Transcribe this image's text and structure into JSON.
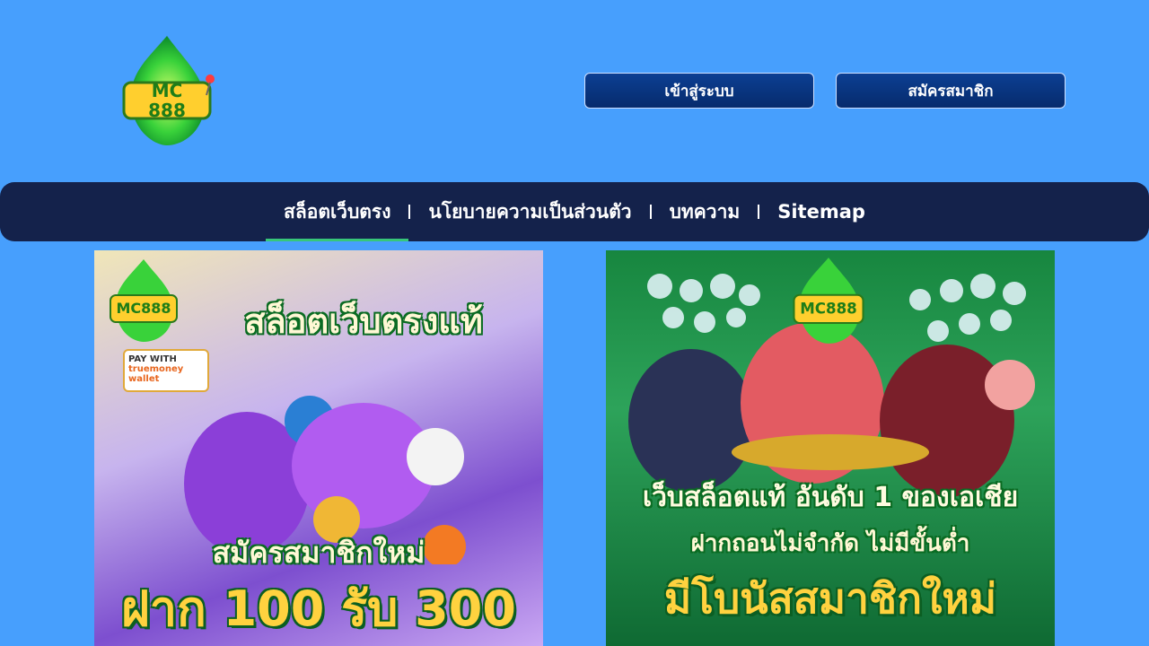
{
  "header": {
    "logo_text": "MC 888",
    "login_label": "เข้าสู่ระบบ",
    "register_label": "สมัครสมาชิก"
  },
  "nav": {
    "items": [
      {
        "label": "สล็อตเว็บตรง",
        "active": true
      },
      {
        "label": "นโยบายความเป็นส่วนตัว"
      },
      {
        "label": "บทความ"
      },
      {
        "label": "Sitemap"
      }
    ]
  },
  "banners": {
    "left": {
      "headline": "สล็อตเว็บตรงแท้",
      "pay_with": "PAY WITH",
      "wallet": "truemoney wallet",
      "promo_line1": "สมัครสมาชิกใหม่",
      "promo_line2": "ฝาก 100 รับ 300"
    },
    "right": {
      "headline": "เว็บสล็อตแท้ อันดับ 1 ของเอเชีย",
      "sub": "ฝากถอนไม่จำกัด ไม่มีขั้นต่ำ",
      "promo": "มีโบนัสสมาชิกใหม่"
    }
  },
  "colors": {
    "background": "#479ffd",
    "navbar": "#14224b",
    "button": "#0c3f93",
    "active_underline": "#37c77a"
  }
}
